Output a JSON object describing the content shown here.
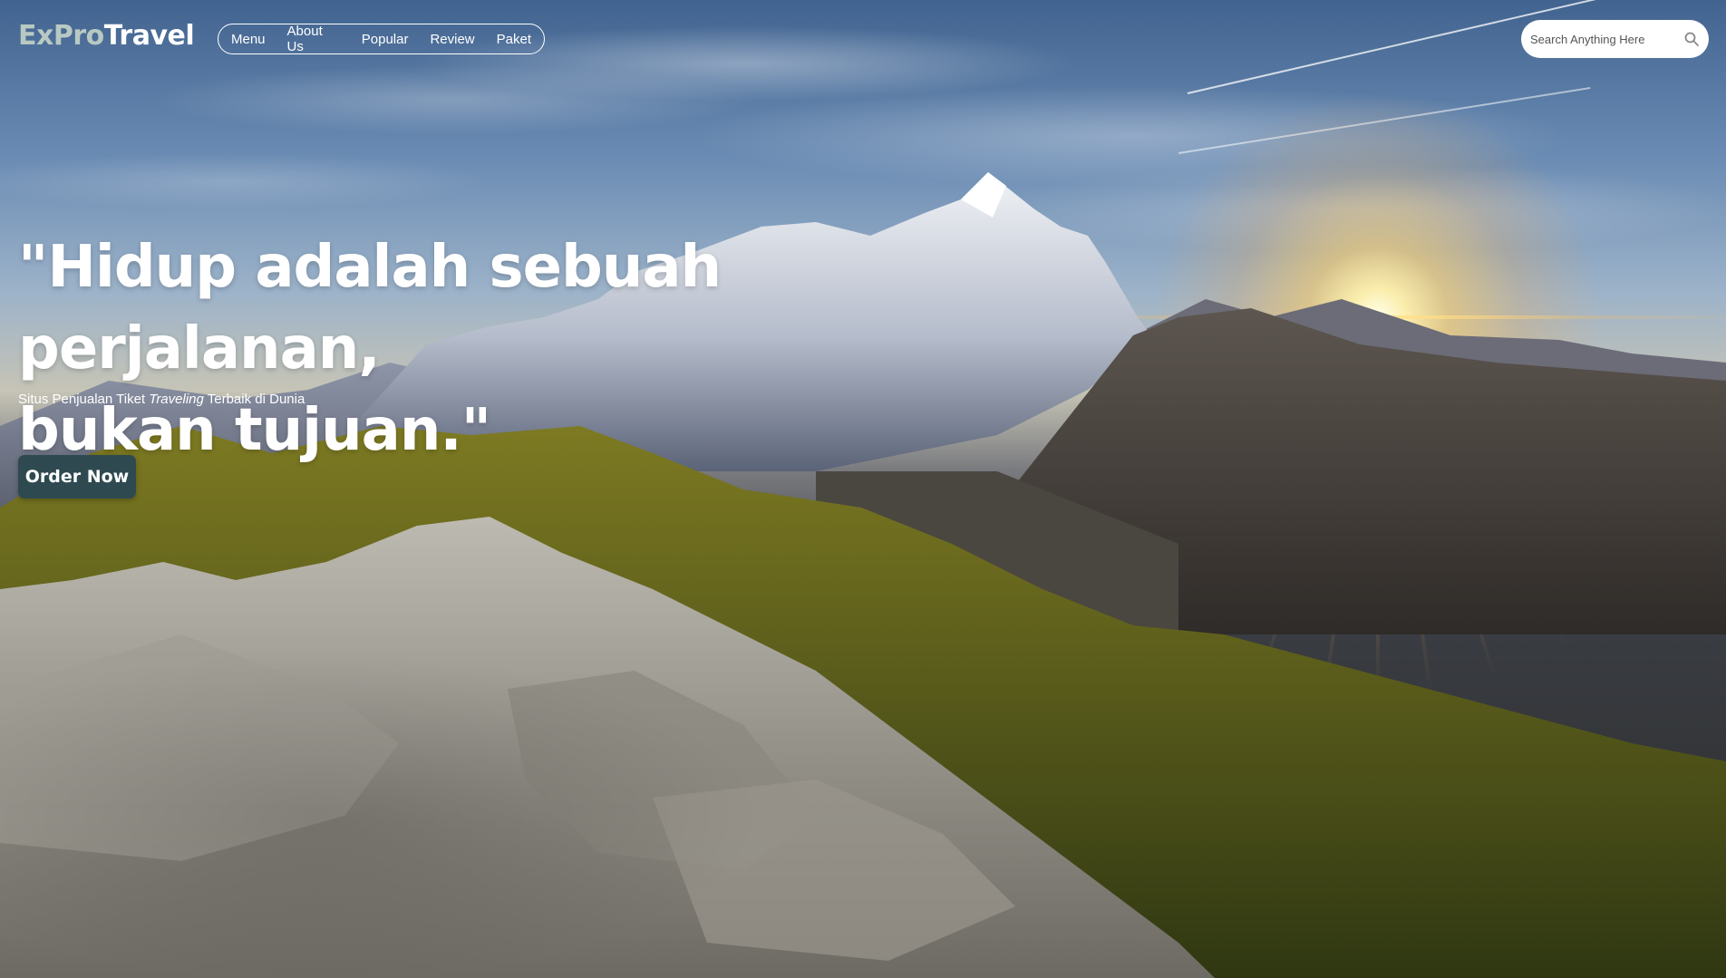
{
  "brand": {
    "logo_part1": "ExPro",
    "logo_part2": "Travel"
  },
  "nav": {
    "items": [
      {
        "label": "Menu"
      },
      {
        "label": "About Us"
      },
      {
        "label": "Popular"
      },
      {
        "label": "Review"
      },
      {
        "label": "Paket"
      }
    ]
  },
  "search": {
    "placeholder": "Search Anything Here",
    "value": "",
    "icon": "search-icon"
  },
  "hero": {
    "headline_line1": "\"Hidup adalah sebuah perjalanan,",
    "headline_line2": "bukan tujuan.\"",
    "subtitle_before": "Situs Penjualan Tiket ",
    "subtitle_emphasis": "Traveling",
    "subtitle_after": " Terbaik di Dunia",
    "cta_label": "Order Now"
  },
  "colors": {
    "text": "#ffffff",
    "logo_accent": "#b8c9c3",
    "cta_background": "#2e4a50",
    "search_background": "#ffffff"
  }
}
